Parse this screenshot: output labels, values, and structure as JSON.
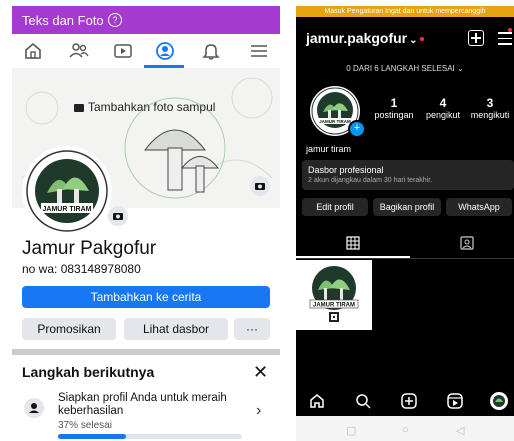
{
  "facebook": {
    "top_title": "Teks dan Foto",
    "top_help_icon": "question-icon",
    "nav": [
      "home-icon",
      "friends-icon",
      "video-icon",
      "profile-icon",
      "bell-icon",
      "menu-icon"
    ],
    "cover_add_label": "Tambahkan foto sampul",
    "profile_name": "Jamur Pakgofur",
    "wa_text": "no wa: 083148978080",
    "story_button": "Tambahkan ke cerita",
    "promo_button": "Promosikan",
    "dashboard_button": "Lihat dasbor",
    "more_button": "···",
    "next_steps_title": "Langkah berikutnya",
    "close_label": "✕",
    "step_text": "Siapkan profil Anda untuk meraih keberhasilan",
    "step_percent": "37% selesai",
    "step_progress": 0.37,
    "logo_text": "JAMUR TIRAM",
    "logo_arc_text": "PAKGOFUR CERINGIN JATI",
    "accent": "#1877f2",
    "top_bar_color": "#a43ad0"
  },
  "instagram": {
    "banner": "Masuk Pengaturan Ingat dan untuk mempercanggih",
    "username": "jamur.pakgofur",
    "steps_text": "0 DARI 6 LANGKAH SELESAI",
    "stats": [
      {
        "value": "1",
        "label": "postingan"
      },
      {
        "value": "4",
        "label": "pengikut"
      },
      {
        "value": "3",
        "label": "mengikuti"
      }
    ],
    "bio_name": "jamur tiram",
    "dashboard_title": "Dasbor profesional",
    "dashboard_sub": "2 akun dijangkau dalam 30 hari terakhir.",
    "buttons": [
      "Edit profil",
      "Bagikan profil",
      "WhatsApp"
    ],
    "tabs": [
      "grid-icon",
      "tagged-icon"
    ],
    "bottom_nav": [
      "home-icon",
      "search-icon",
      "create-icon",
      "reels-icon",
      "profile-avatar-icon"
    ],
    "logo_text": "JAMUR TIRAM"
  }
}
